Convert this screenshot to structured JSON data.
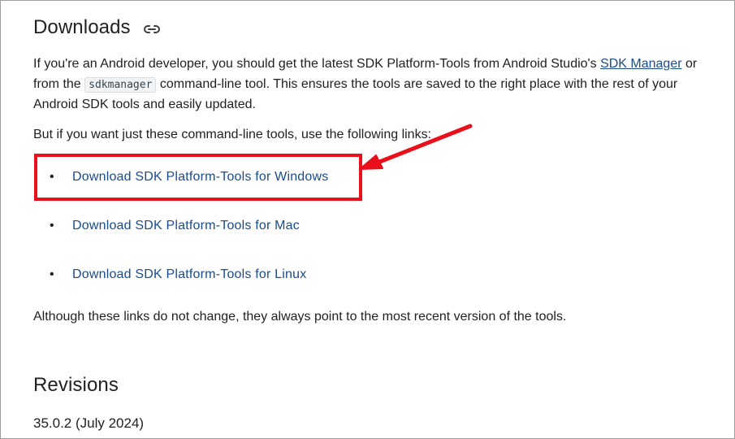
{
  "downloads": {
    "heading": "Downloads",
    "link_icon": "link-icon",
    "intro": {
      "part1": "If you're an Android developer, you should get the latest SDK Platform-Tools from Android Studio's ",
      "sdk_manager_link": "SDK Manager",
      "part2": " or from the ",
      "code": "sdkmanager",
      "part3": " command-line tool. This ensures the tools are saved to the right place with the rest of your Android SDK tools and easily updated."
    },
    "but_text": "But if you want just these command-line tools, use the following links:",
    "links": [
      "Download SDK Platform-Tools for Windows",
      "Download SDK Platform-Tools for Mac",
      "Download SDK Platform-Tools for Linux"
    ],
    "bullet": "•",
    "although_text": "Although these links do not change, they always point to the most recent version of the tools."
  },
  "revisions": {
    "heading": "Revisions",
    "version": "35.0.2 (July 2024)"
  },
  "colors": {
    "link": "#1a4b8c",
    "highlight": "#e8101a",
    "text": "#202124"
  }
}
